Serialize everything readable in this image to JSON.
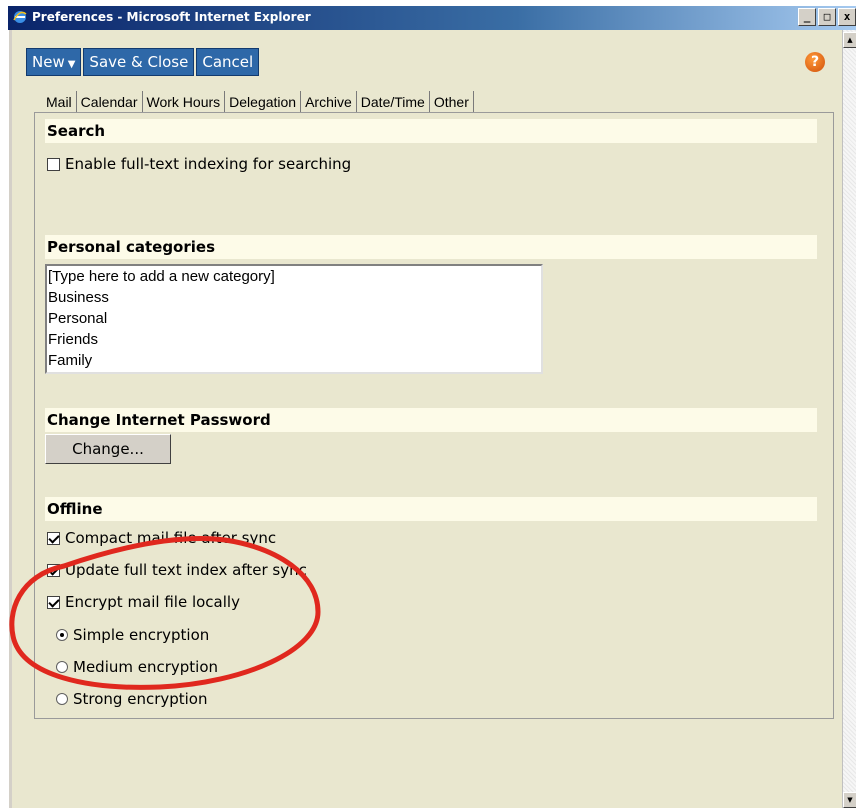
{
  "window": {
    "title": "Preferences - Microsoft Internet Explorer",
    "min_label": "_",
    "max_label": "□",
    "close_label": "x"
  },
  "toolbar": {
    "new_label": "New",
    "save_close_label": "Save & Close",
    "cancel_label": "Cancel",
    "help_label": "?"
  },
  "tabs": [
    "Mail",
    "Calendar",
    "Work Hours",
    "Delegation",
    "Archive",
    "Date/Time",
    "Other"
  ],
  "search": {
    "heading": "Search",
    "enable_fulltext_label": "Enable full-text indexing for searching",
    "enable_fulltext_checked": false
  },
  "categories": {
    "heading": "Personal categories",
    "items": [
      "[Type here to add a new category]",
      "Business",
      "Personal",
      "Friends",
      "Family"
    ]
  },
  "password": {
    "heading": "Change Internet Password",
    "change_label": "Change..."
  },
  "offline": {
    "heading": "Offline",
    "compact_label": "Compact mail file after sync",
    "compact_checked": true,
    "update_index_label": "Update full text index after sync",
    "update_index_checked": true,
    "encrypt_label": "Encrypt mail file locally",
    "encrypt_checked": true,
    "encryption_options": [
      "Simple encryption",
      "Medium encryption",
      "Strong encryption"
    ],
    "selected_encryption": "Simple encryption"
  },
  "colors": {
    "toolbar_button": "#2e68a8",
    "content_bg": "#e9e7cf",
    "section_header_bg": "#fdfbe8",
    "annotation_circle": "#e0281e"
  }
}
